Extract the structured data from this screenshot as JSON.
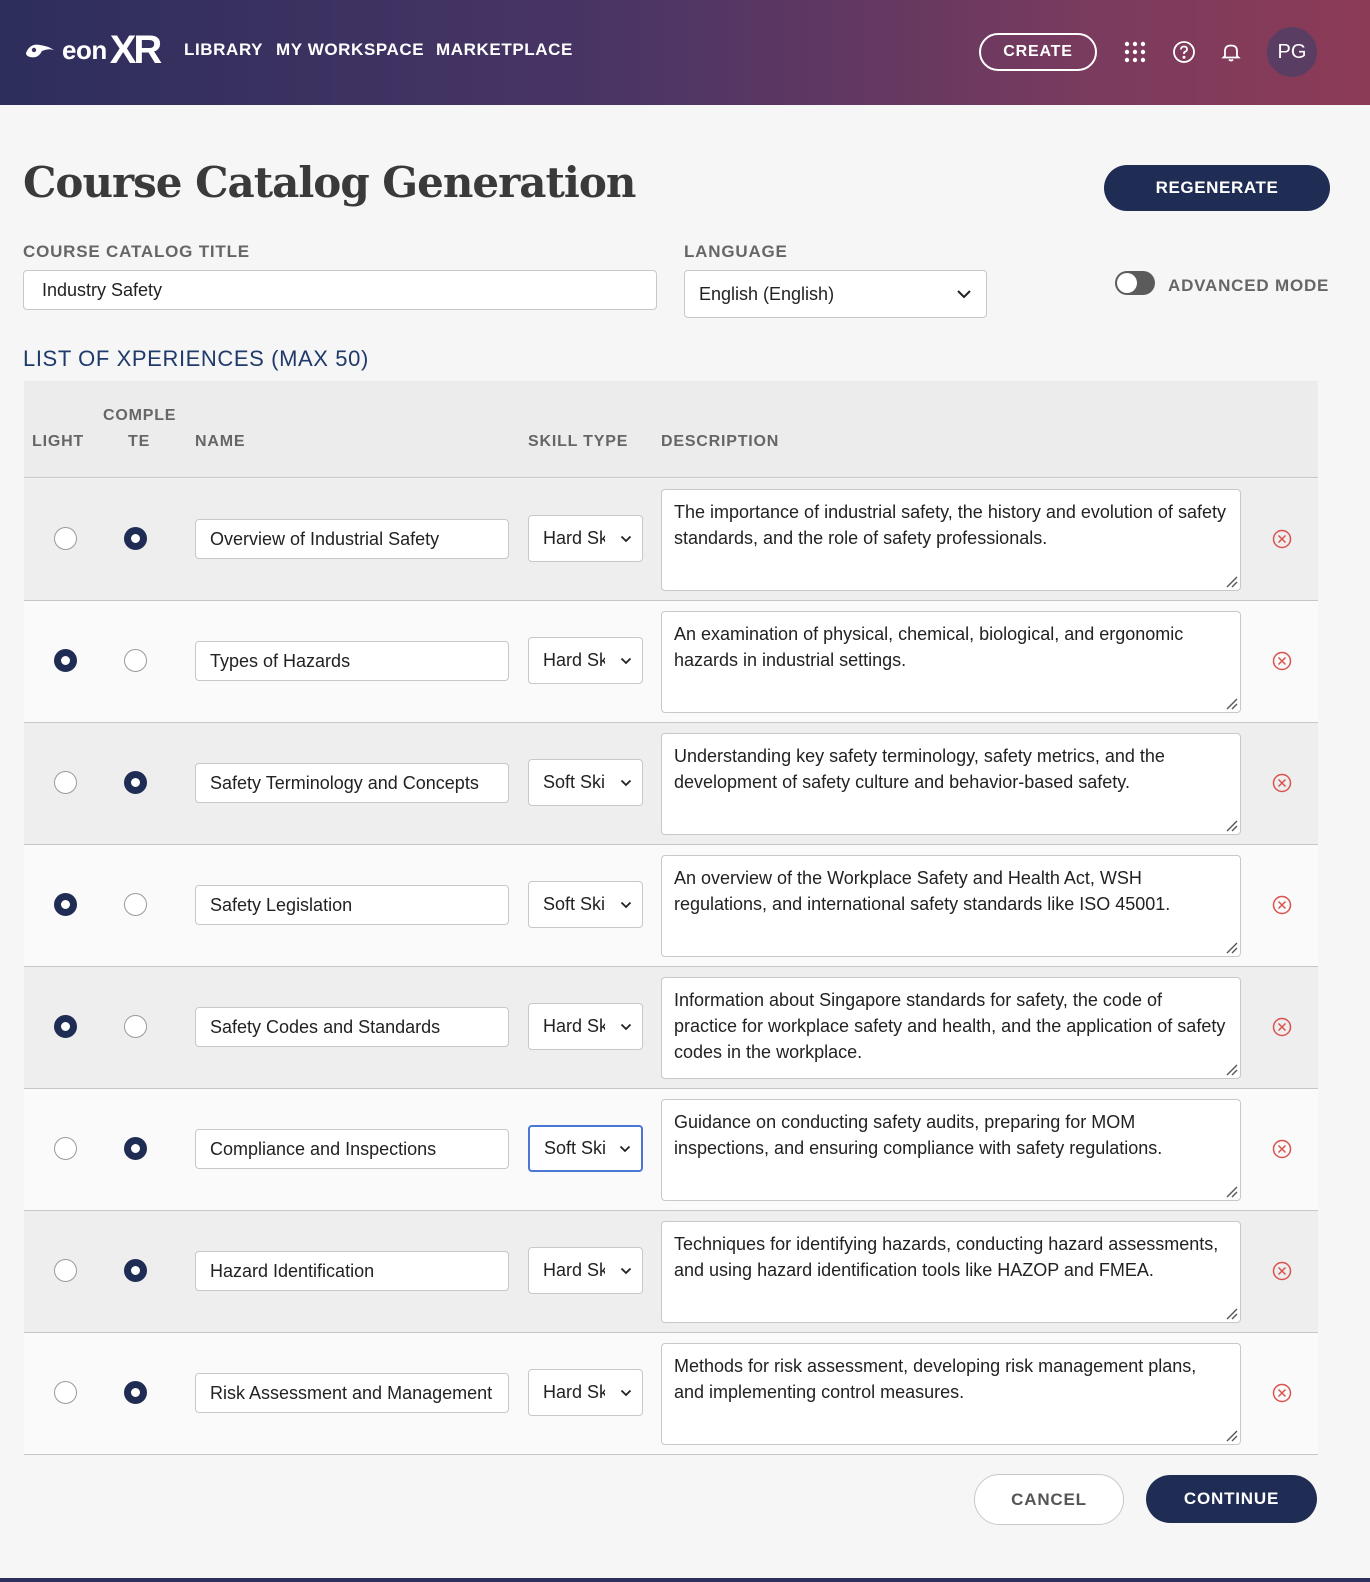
{
  "header": {
    "logo_text": "eon",
    "logo_xr": "XR",
    "nav": [
      "LIBRARY",
      "MY WORKSPACE",
      "MARKETPLACE"
    ],
    "create_label": "CREATE",
    "avatar_initials": "PG"
  },
  "page": {
    "title": "Course Catalog Generation",
    "regenerate_label": "REGENERATE"
  },
  "form": {
    "title_label": "COURSE CATALOG TITLE",
    "title_value": "Industry Safety",
    "language_label": "LANGUAGE",
    "language_value": "English (English)",
    "advanced_mode_label": "ADVANCED MODE",
    "advanced_mode_on": false
  },
  "list": {
    "title": "LIST OF XPERIENCES (MAX 50)",
    "columns": {
      "light": "LIGHT",
      "complete_1": "COMPLE",
      "complete_2": "TE",
      "name": "NAME",
      "skill_type": "SKILL TYPE",
      "description": "DESCRIPTION"
    },
    "rows": [
      {
        "light": false,
        "complete": true,
        "name": "Overview of Industrial Safety",
        "skill": "Hard Skill",
        "description": "The importance of industrial safety, the history and evolution of safety standards, and the role of safety professionals."
      },
      {
        "light": true,
        "complete": false,
        "name": "Types of Hazards",
        "skill": "Hard Skill",
        "description": "An examination of physical, chemical, biological, and ergonomic hazards in industrial settings."
      },
      {
        "light": false,
        "complete": true,
        "name": "Safety Terminology and Concepts",
        "skill": "Soft Skill",
        "description": "Understanding key safety terminology, safety metrics, and the development of safety culture and behavior-based safety."
      },
      {
        "light": true,
        "complete": false,
        "name": "Safety Legislation",
        "skill": "Soft Skill",
        "description": "An overview of the Workplace Safety and Health Act, WSH regulations, and international safety standards like ISO 45001."
      },
      {
        "light": true,
        "complete": false,
        "name": "Safety Codes and Standards",
        "skill": "Hard Skill",
        "description": "Information about Singapore standards for safety, the code of practice for workplace safety and health, and the application of safety codes in the workplace."
      },
      {
        "light": false,
        "complete": true,
        "name": "Compliance and Inspections",
        "skill": "Soft Skill",
        "description": "Guidance on conducting safety audits, preparing for MOM inspections, and ensuring compliance with safety regulations."
      },
      {
        "light": false,
        "complete": true,
        "name": "Hazard Identification",
        "skill": "Hard Skill",
        "description": "Techniques for identifying hazards, conducting hazard assessments, and using hazard identification tools like HAZOP and FMEA."
      },
      {
        "light": false,
        "complete": true,
        "name": "Risk Assessment and Management",
        "skill": "Hard Skill",
        "description": "Methods for risk assessment, developing risk management plans, and implementing control measures."
      }
    ]
  },
  "footer": {
    "cancel_label": "CANCEL",
    "continue_label": "CONTINUE"
  },
  "colors": {
    "primary": "#1f2d54",
    "remove_icon": "#d9534f",
    "focus_border": "#4a76d6"
  }
}
